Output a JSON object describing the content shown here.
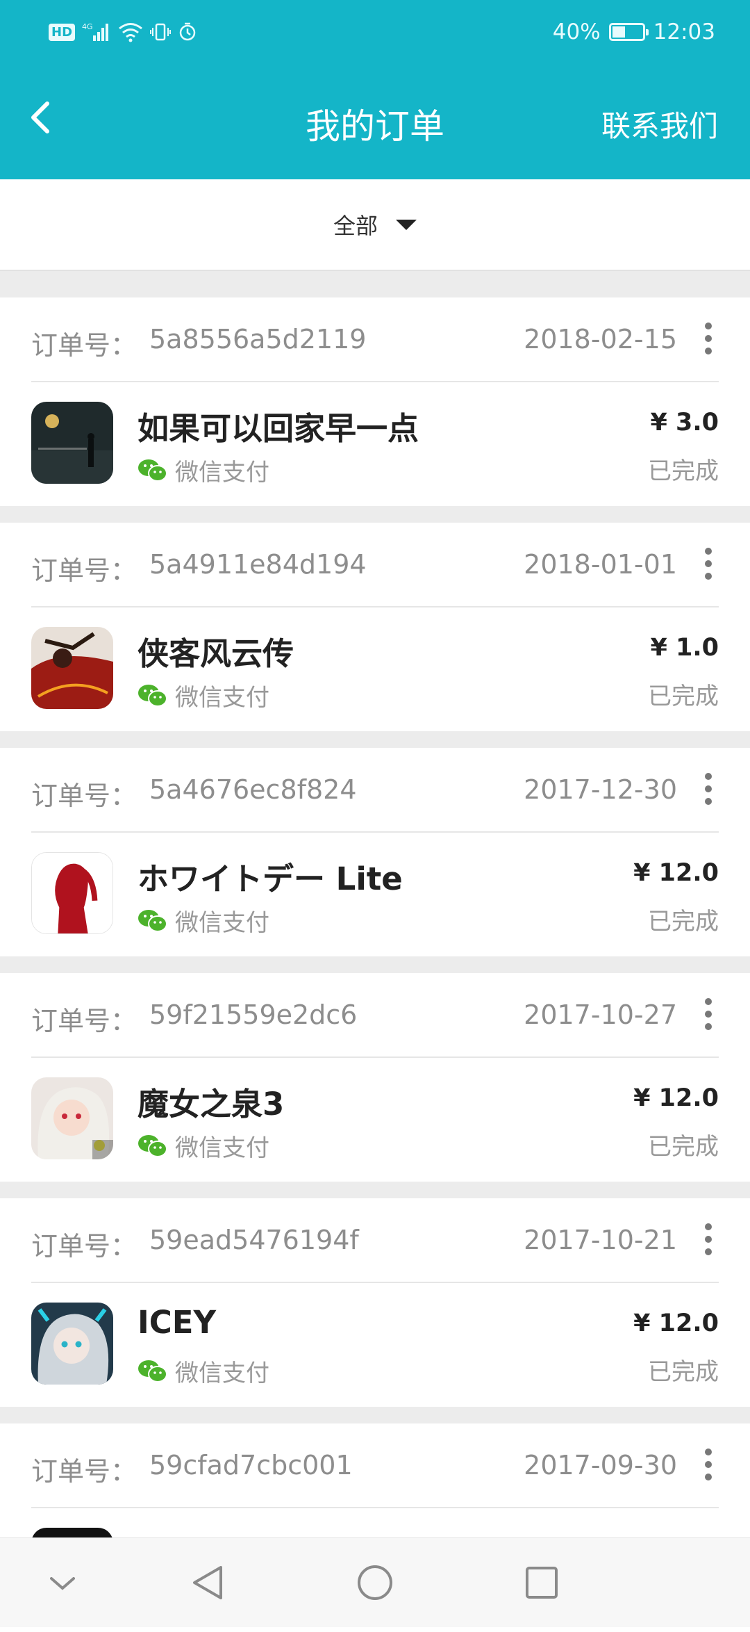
{
  "status_bar": {
    "hd": "HD",
    "network": "4G",
    "battery_percent": "40%",
    "battery_level": 0.4,
    "time": "12:03"
  },
  "app_bar": {
    "title": "我的订单",
    "contact": "联系我们",
    "back_icon": "back-arrow-icon"
  },
  "filter": {
    "label": "全部",
    "icon": "dropdown-triangle-icon"
  },
  "order_no_label": "订单号：",
  "orders": [
    {
      "order_no": "5a8556a5d2119",
      "date": "2018-02-15",
      "app_name": "如果可以回家早一点",
      "payment": "微信支付",
      "price": "¥ 3.0",
      "status": "已完成"
    },
    {
      "order_no": "5a4911e84d194",
      "date": "2018-01-01",
      "app_name": "侠客风云传",
      "payment": "微信支付",
      "price": "¥ 1.0",
      "status": "已完成"
    },
    {
      "order_no": "5a4676ec8f824",
      "date": "2017-12-30",
      "app_name": "ホワイトデー Lite",
      "payment": "微信支付",
      "price": "¥ 12.0",
      "status": "已完成"
    },
    {
      "order_no": "59f21559e2dc6",
      "date": "2017-10-27",
      "app_name": "魔女之泉3",
      "payment": "微信支付",
      "price": "¥ 12.0",
      "status": "已完成"
    },
    {
      "order_no": "59ead5476194f",
      "date": "2017-10-21",
      "app_name": "ICEY",
      "payment": "微信支付",
      "price": "¥ 12.0",
      "status": "已完成"
    },
    {
      "order_no": "59cfad7cbc001",
      "date": "2017-09-30",
      "app_name": "",
      "payment": "",
      "price": "",
      "status": ""
    }
  ],
  "colors": {
    "primary": "#14b5c8",
    "wechat_green": "#4cb22b"
  },
  "nav_bar": {
    "icons": [
      "collapse-chevron-icon",
      "back-triangle-icon",
      "home-circle-icon",
      "recents-square-icon"
    ]
  }
}
